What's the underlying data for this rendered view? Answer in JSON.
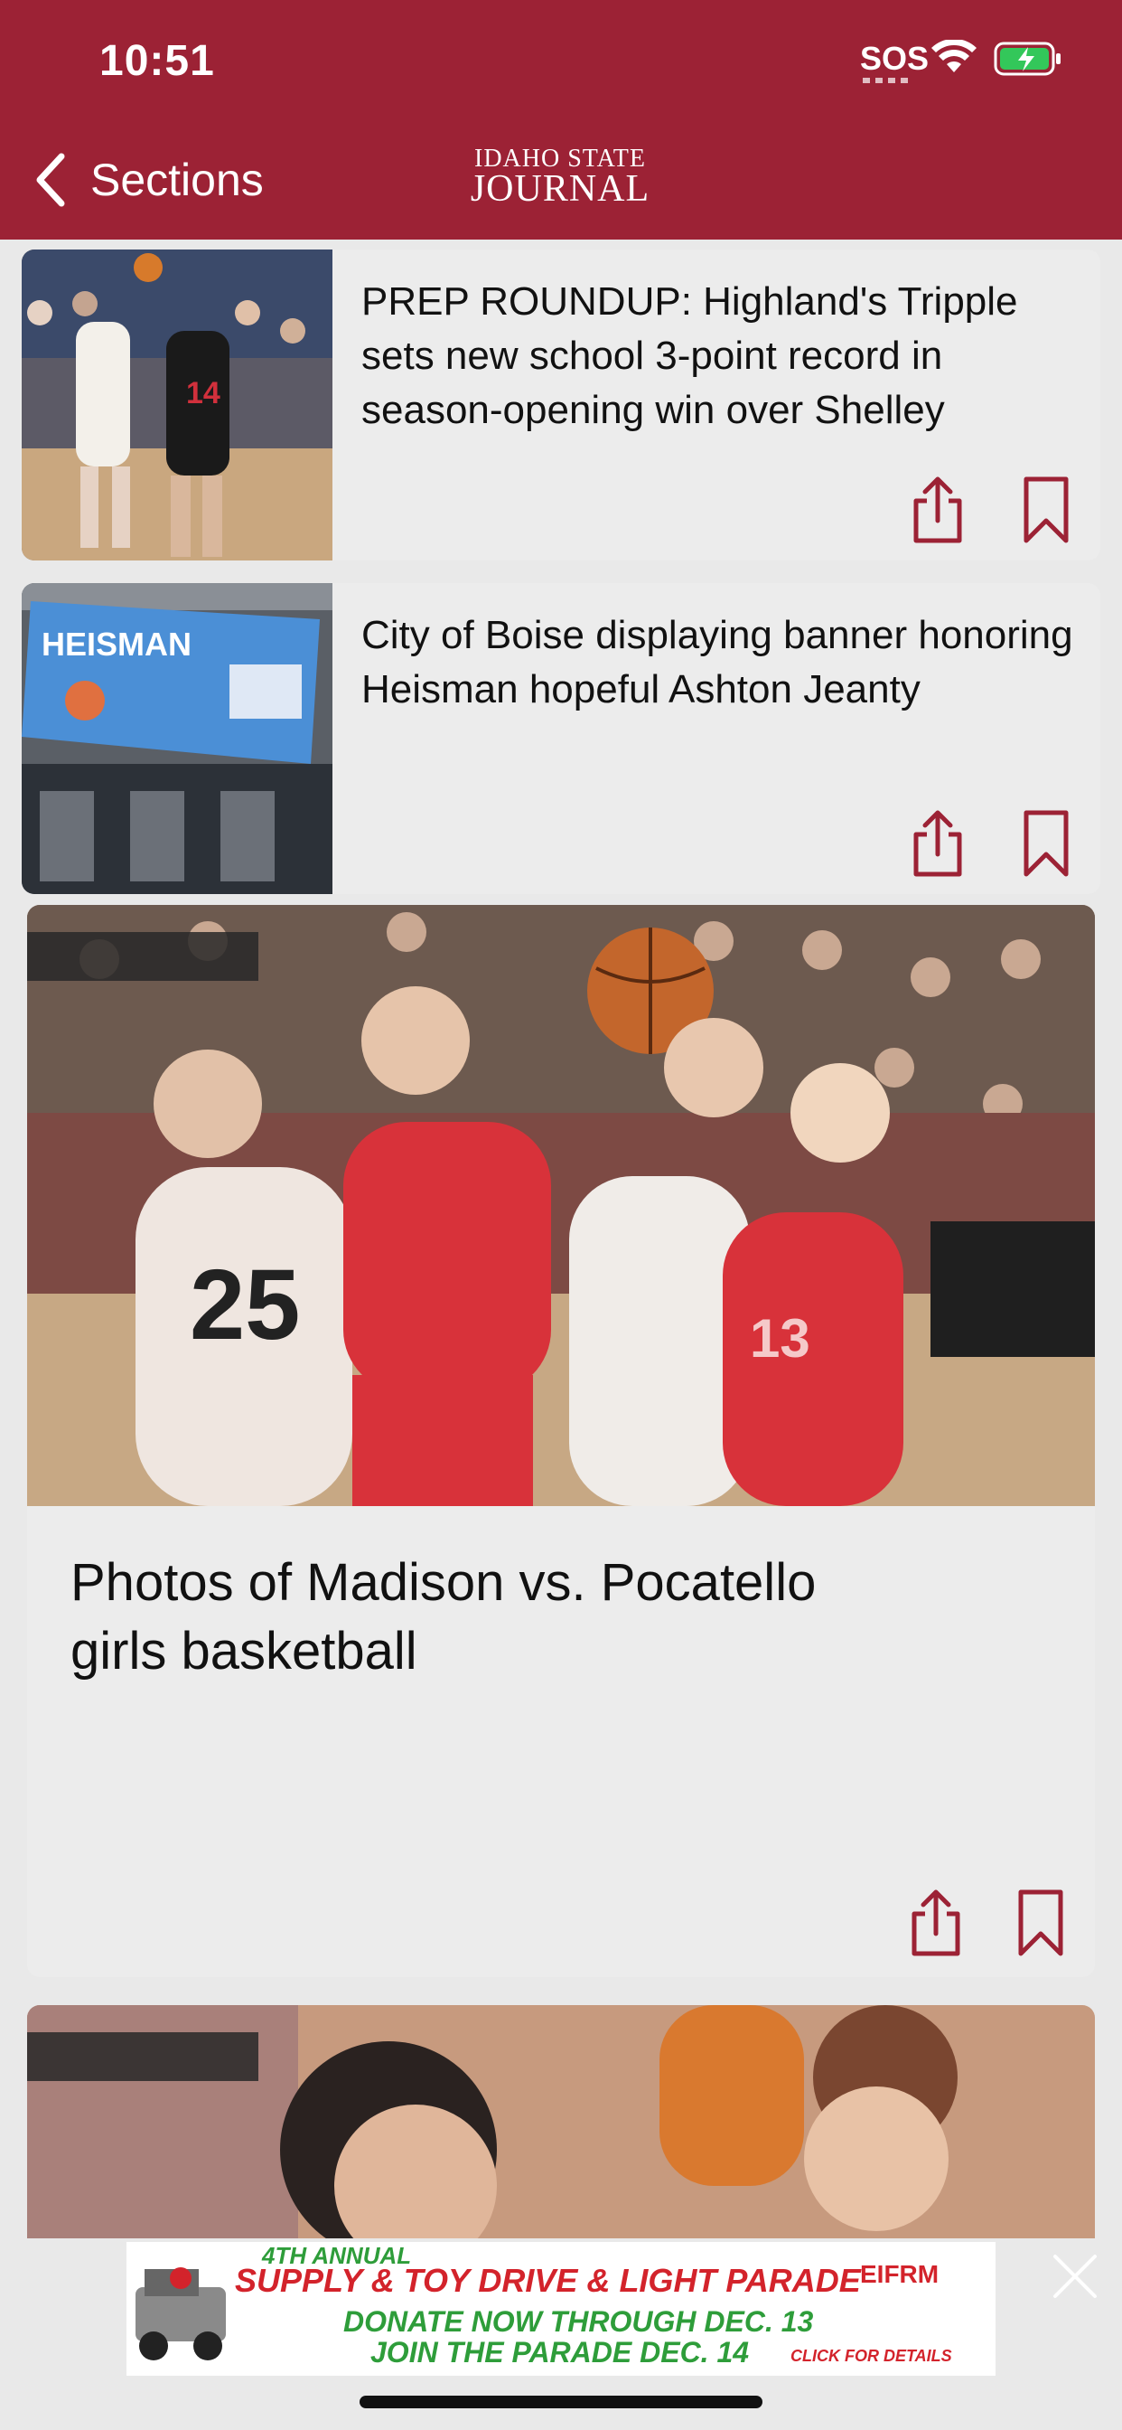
{
  "status_bar": {
    "time": "10:51",
    "carrier": "SOS"
  },
  "nav": {
    "back_label": "Sections",
    "logo_top": "Idaho State",
    "logo_bottom": "Journal"
  },
  "articles": [
    {
      "headline": "PREP ROUNDUP: Highland's Tripple sets new school 3-point record in season-opening win over Shelley",
      "thumb_text": "14"
    },
    {
      "headline": "City of Boise displaying banner honoring Heisman hopeful Ashton Jeanty",
      "thumb_text": "HEISMAN"
    }
  ],
  "featured": {
    "headline": "Photos of Madison vs. Pocatello girls basketball"
  },
  "ad": {
    "line1": "4TH ANNUAL",
    "line2": "SUPPLY & TOY DRIVE & LIGHT PARADE",
    "line3": "DONATE NOW THROUGH DEC. 13",
    "line4": "JOIN THE PARADE DEC. 14",
    "cta": "CLICK FOR DETAILS",
    "org": "EIFRM"
  },
  "colors": {
    "brand": "#9c2235",
    "card_bg": "#ececec",
    "icon": "#9c2235"
  }
}
